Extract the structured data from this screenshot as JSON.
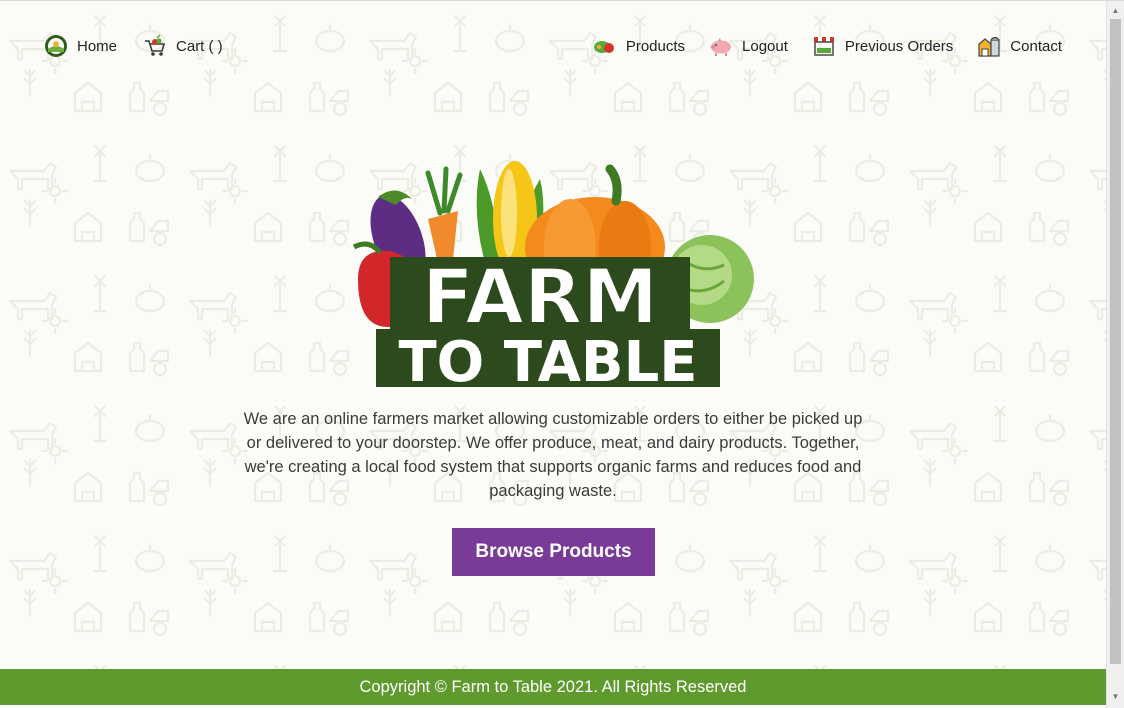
{
  "nav": {
    "left": [
      {
        "label": "Home",
        "icon": "farm-logo-icon"
      },
      {
        "label": "Cart ( )",
        "icon": "cart-icon"
      }
    ],
    "right": [
      {
        "label": "Products",
        "icon": "vegetables-icon"
      },
      {
        "label": "Logout",
        "icon": "pig-icon"
      },
      {
        "label": "Previous Orders",
        "icon": "market-stall-icon"
      },
      {
        "label": "Contact",
        "icon": "barn-icon"
      }
    ]
  },
  "logo": {
    "line1": "FARM",
    "line2": "TO TABLE"
  },
  "intro_text": "We are an online farmers market allowing customizable orders to either be picked up or delivered to your doorstep. We offer produce, meat, and dairy products. Together, we're creating a local food system that supports organic farms and reduces food and packaging waste.",
  "browse_button": "Browse Products",
  "footer_text": "Copyright © Farm to Table 2021. All Rights Reserved",
  "colors": {
    "accent_purple": "#7a3b98",
    "footer_green": "#5e9a2e",
    "logo_dark_green": "#2c4a1c"
  }
}
